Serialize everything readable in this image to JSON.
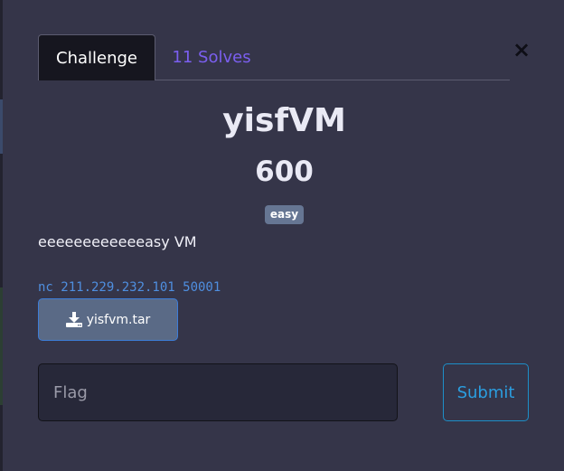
{
  "modal": {
    "close_label": "×"
  },
  "tabs": [
    {
      "label": "Challenge",
      "active": true
    },
    {
      "label": "11 Solves",
      "active": false
    }
  ],
  "challenge": {
    "name": "yisfVM",
    "points": "600",
    "difficulty": "easy",
    "description": "eeeeeeeeeeeeasy VM",
    "connection": "nc 211.229.232.101 50001",
    "file": {
      "icon": "download-icon",
      "label": "yisfvm.tar"
    }
  },
  "submission": {
    "placeholder": "Flag",
    "value": "",
    "submit_label": "Submit"
  },
  "colors": {
    "modal_bg": "#353549",
    "tab_active_bg": "#16161f",
    "tab_inactive_text": "#7b5ff0",
    "badge_bg": "#667693",
    "connection_text": "#4f8fe0",
    "file_button_bg": "#5a6a86",
    "submit_border": "#1d8fc8"
  }
}
